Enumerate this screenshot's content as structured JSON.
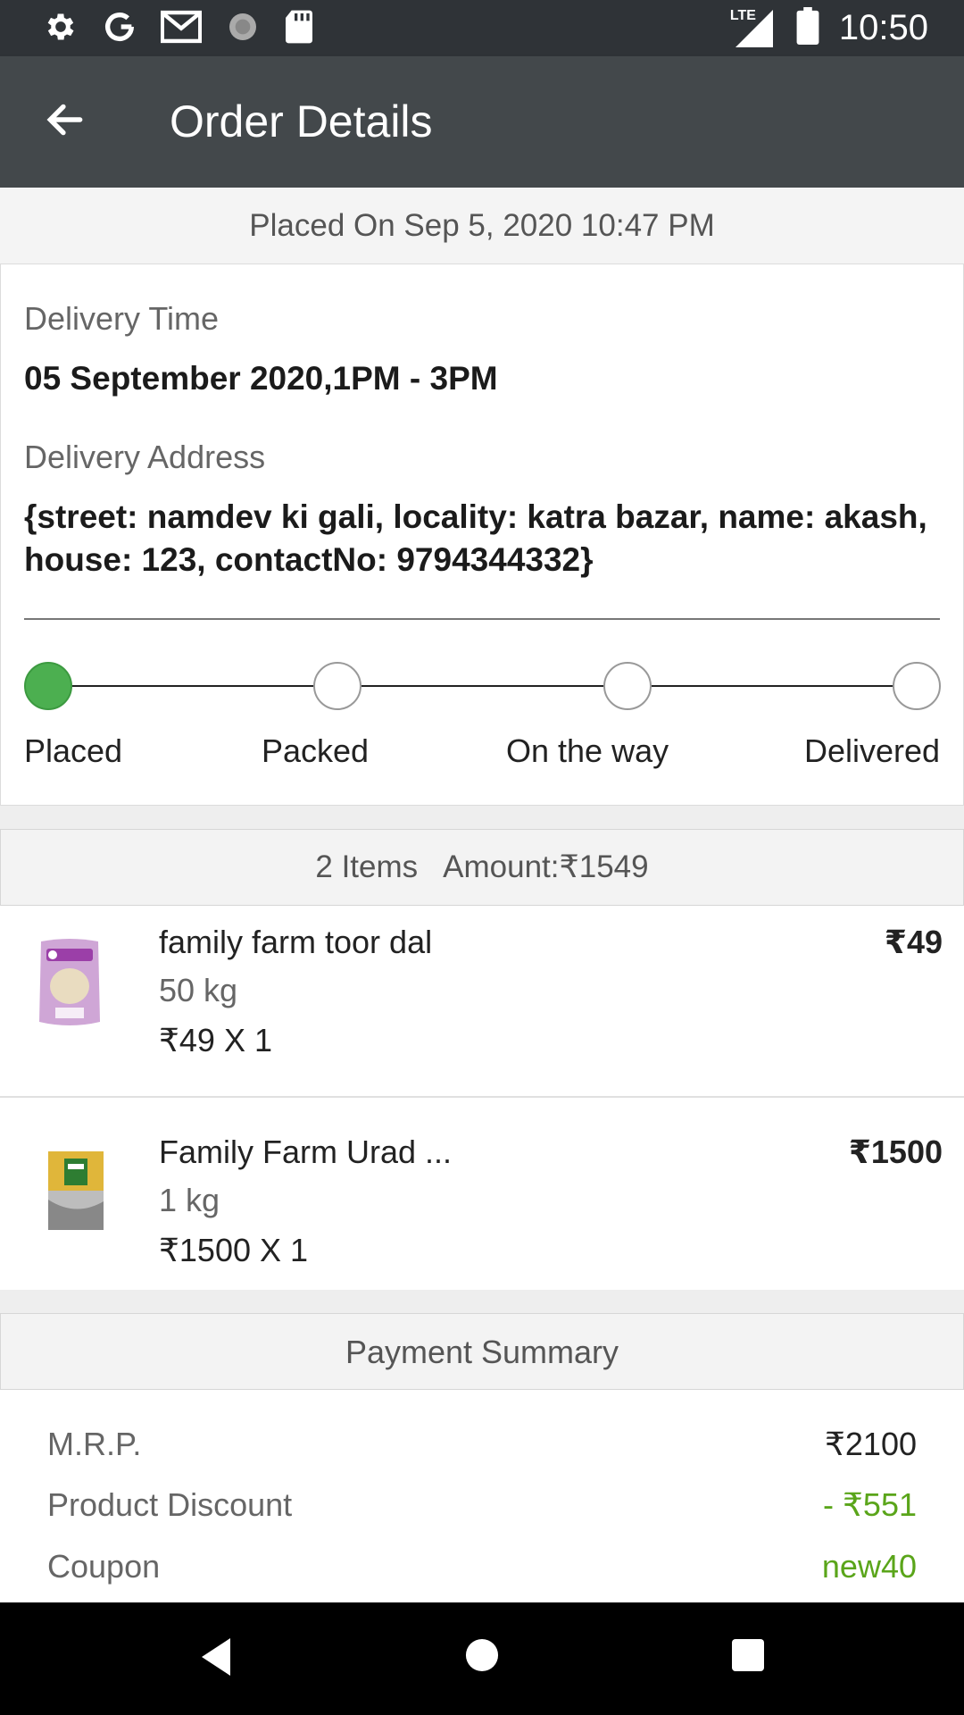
{
  "status_bar": {
    "time": "10:50",
    "network": "LTE",
    "icons": [
      "gear-icon",
      "google-icon",
      "gmail-icon",
      "sync-icon",
      "sdcard-icon",
      "signal-icon",
      "battery-icon"
    ]
  },
  "app_bar": {
    "title": "Order Details"
  },
  "order": {
    "placed_on": "Placed On Sep 5, 2020 10:47 PM",
    "delivery_time_label": "Delivery Time",
    "delivery_time": "05 September 2020,1PM - 3PM",
    "delivery_address_label": "Delivery Address",
    "delivery_address": "{street: namdev ki gali, locality: katra bazar, name: akash, house: 123, contactNo: 9794344332}"
  },
  "tracker": {
    "steps": [
      "Placed",
      "Packed",
      "On the way",
      "Delivered"
    ],
    "active_index": 0,
    "active_color": "#4caf50"
  },
  "items_summary": {
    "count": "2 Items",
    "amount": "Amount:₹1549"
  },
  "items": [
    {
      "name": "family farm toor dal",
      "qty": "50 kg",
      "unit_line": "₹49 X 1",
      "price": "₹49"
    },
    {
      "name": "Family Farm Urad ...",
      "qty": "1 kg",
      "unit_line": "₹1500 X 1",
      "price": "₹1500"
    }
  ],
  "payment": {
    "header": "Payment Summary",
    "mrp_label": "M.R.P.",
    "mrp_value": "₹2100",
    "discount_label": "Product Discount",
    "discount_value": "- ₹551",
    "coupon_label": "Coupon",
    "coupon_value": "new40",
    "accent_green": "#5aa51a"
  }
}
